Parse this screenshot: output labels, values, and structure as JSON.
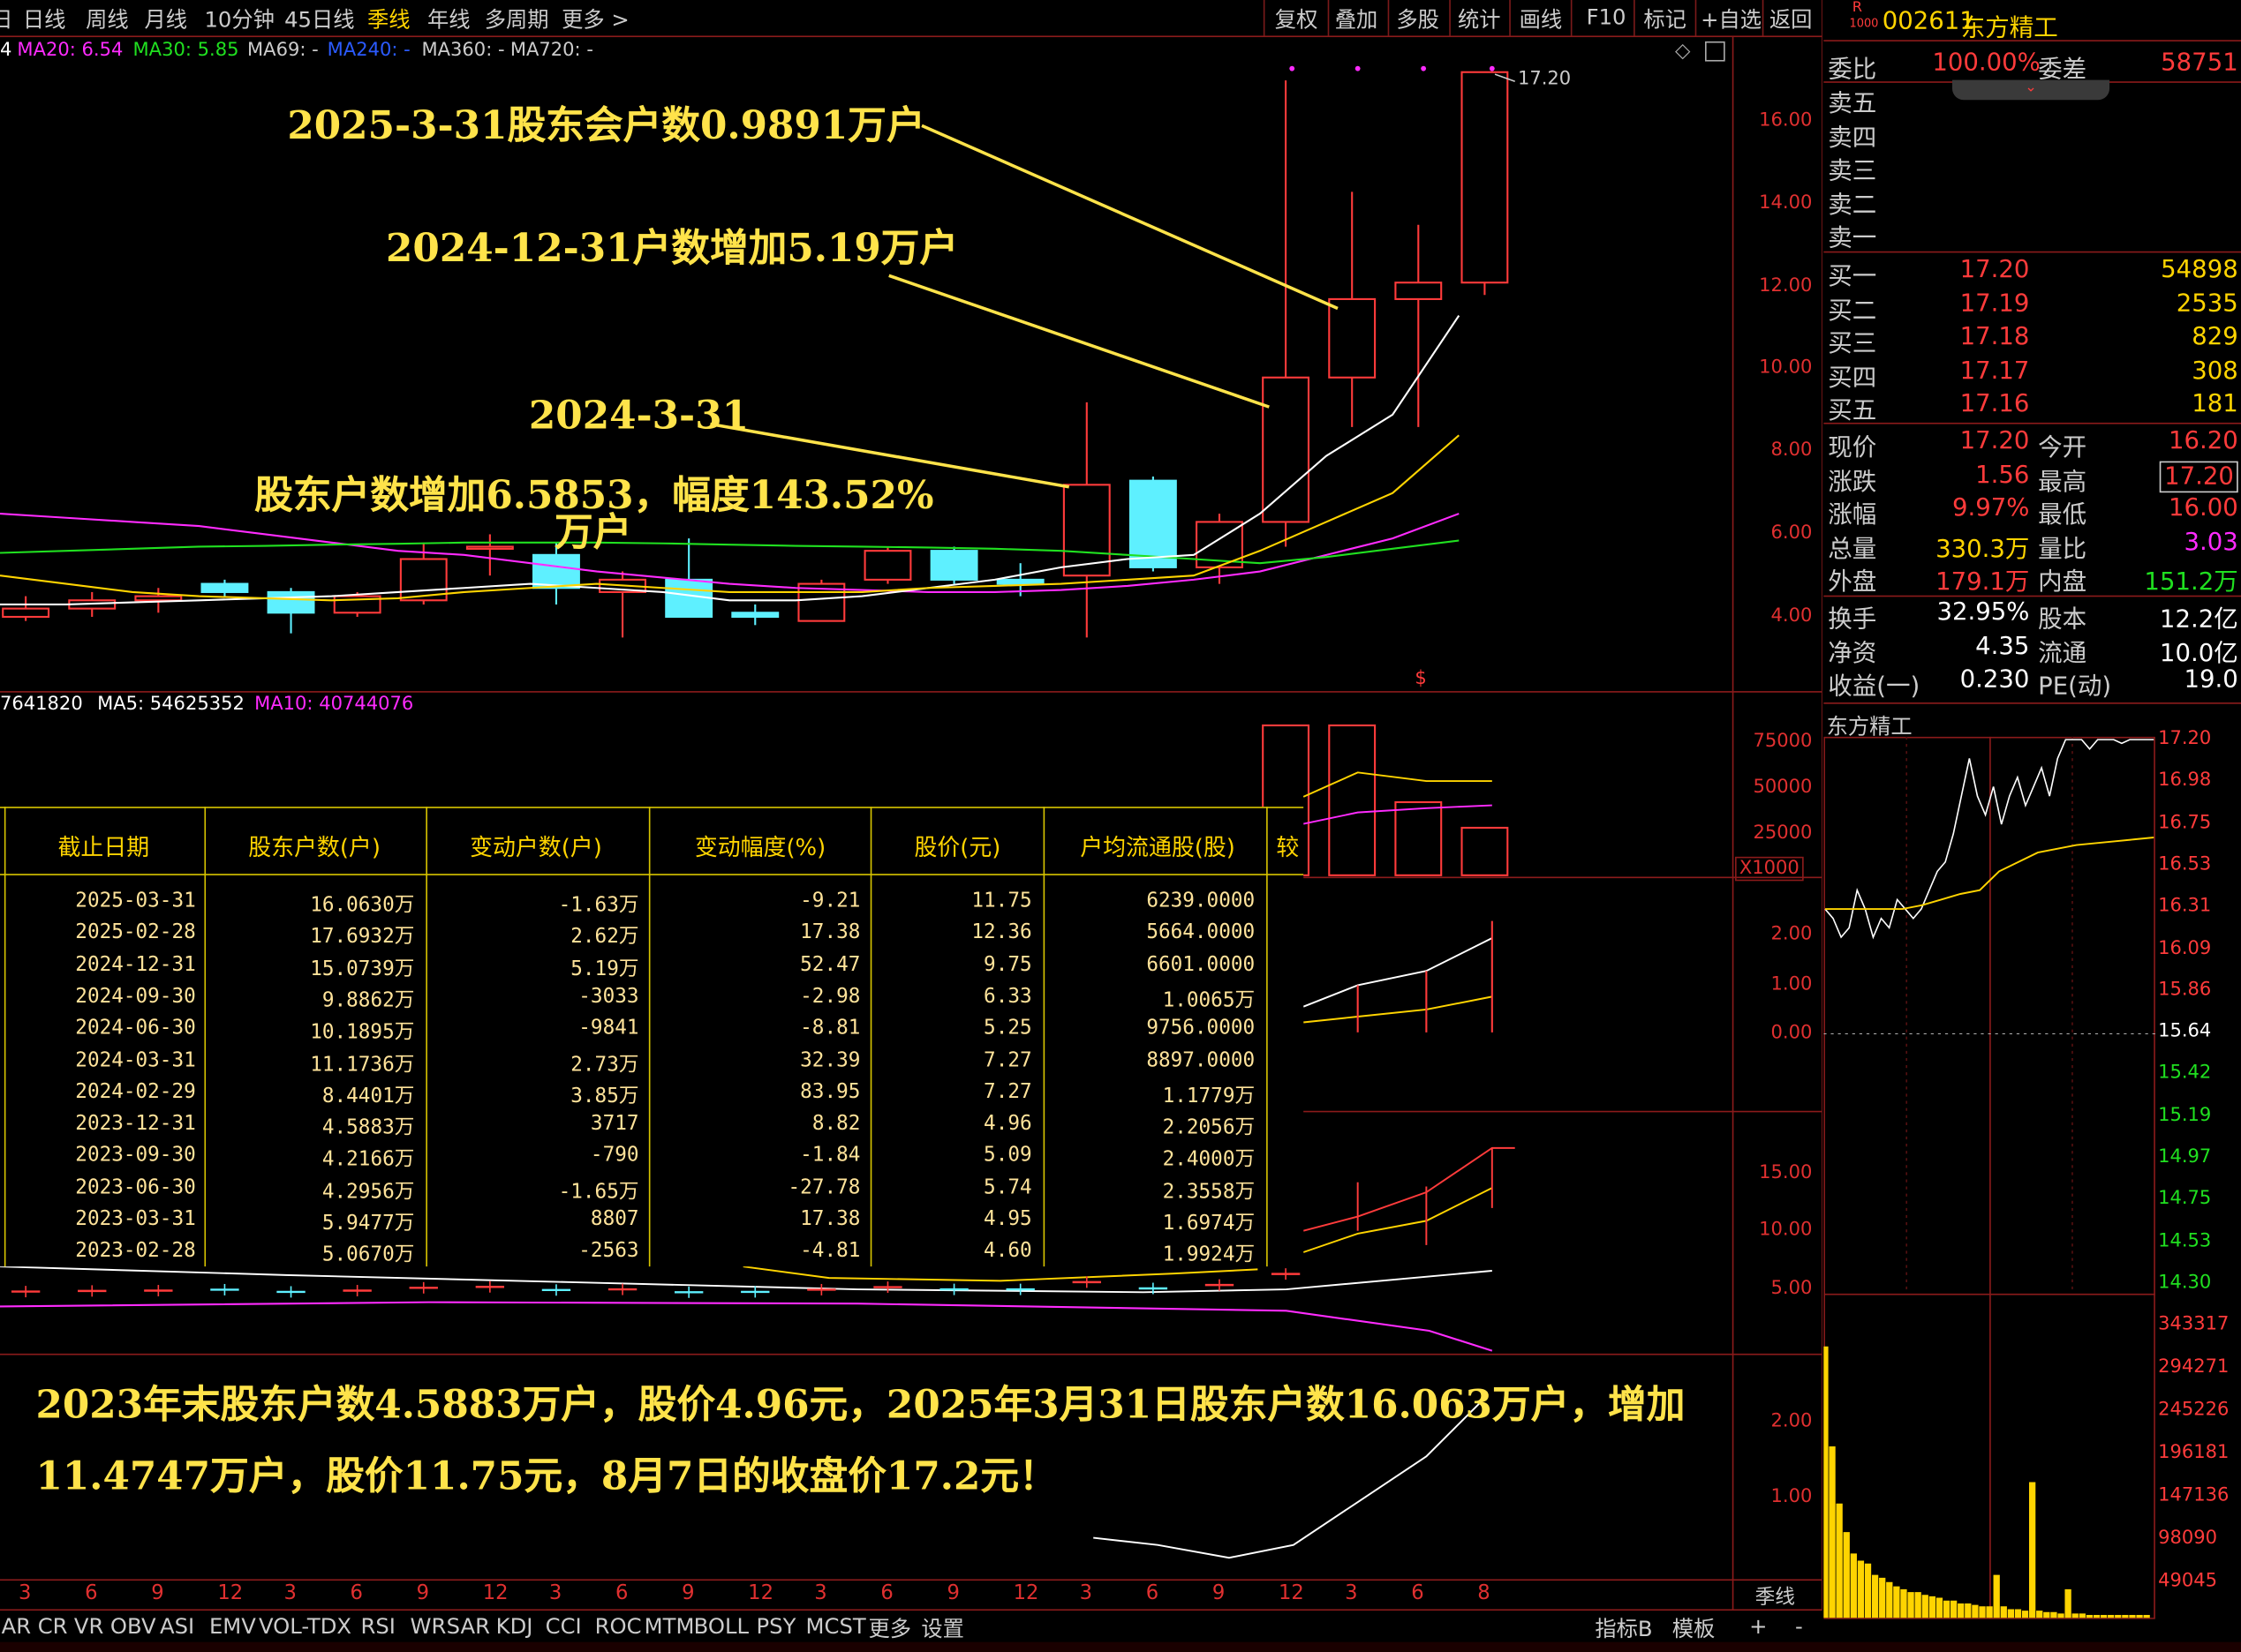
{
  "periods": [
    "日线",
    "周线",
    "月线",
    "10分钟",
    "45日线",
    "季线",
    "年线",
    "多周期",
    "更多 >"
  ],
  "active_period": "季线",
  "tools": [
    "复权",
    "叠加",
    "多股",
    "统计",
    "画线",
    "F10",
    "标记",
    "+自选",
    "返回"
  ],
  "stock": {
    "code": "002611",
    "name": "东方精工",
    "badge_top": "R",
    "badge_bottom": "1000"
  },
  "ma_line": [
    {
      "text": "4",
      "color": "#ffffff"
    },
    {
      "text": "MA20: 6.54",
      "color": "#ff2bff"
    },
    {
      "text": "MA30: 5.85",
      "color": "#20e020"
    },
    {
      "text": "MA69: -",
      "color": "#cccccc"
    },
    {
      "text": "MA240: -",
      "color": "#2b5bff"
    },
    {
      "text": "MA360: -",
      "color": "#cccccc"
    },
    {
      "text": "MA720: -",
      "color": "#cccccc"
    }
  ],
  "price_axis": [
    "16.00",
    "14.00",
    "12.00",
    "10.00",
    "8.00",
    "6.00",
    "4.00"
  ],
  "last_price_tag": "17.20",
  "vol_ma_line": [
    {
      "text": "7641820",
      "color": "#ffffff"
    },
    {
      "text": "MA5: 54625352",
      "color": "#ffffff"
    },
    {
      "text": "MA10: 40744076",
      "color": "#ff2bff"
    }
  ],
  "vol_axis": [
    "75000",
    "50000",
    "25000"
  ],
  "vol_unit": "X1000",
  "ind1_axis": [
    "2.00",
    "1.00",
    "0.00"
  ],
  "ind2_axis": [
    "15.00",
    "10.00",
    "5.00"
  ],
  "ind3_axis": [
    "2.00",
    "1.00"
  ],
  "marker_dollar": "$",
  "annotations": {
    "a1": "2025-3-31股东会户数0.9891万户",
    "a2": "2024-12-31户数增加5.19万户",
    "a3": "2024-3-31",
    "a4": "股东户数增加6.5853，幅度143.52%",
    "a4b": "万户",
    "bottom1": "2023年末股东户数4.5883万户，股价4.96元，2025年3月31日股东户数16.063万户，增加",
    "bottom2": "11.4747万户，股价11.75元，8月7日的收盘价17.2元！"
  },
  "table": {
    "headers": [
      "截止日期",
      "股东户数(户)",
      "变动户数(户)",
      "变动幅度(%)",
      "股价(元)",
      "户均流通股(股)",
      "较"
    ],
    "rows": [
      [
        "2025-03-31",
        "16.0630万",
        "-1.63万",
        "-9.21",
        "11.75",
        "6239.0000"
      ],
      [
        "2025-02-28",
        "17.6932万",
        "2.62万",
        "17.38",
        "12.36",
        "5664.0000"
      ],
      [
        "2024-12-31",
        "15.0739万",
        "5.19万",
        "52.47",
        "9.75",
        "6601.0000"
      ],
      [
        "2024-09-30",
        "9.8862万",
        "-3033",
        "-2.98",
        "6.33",
        "1.0065万"
      ],
      [
        "2024-06-30",
        "10.1895万",
        "-9841",
        "-8.81",
        "5.25",
        "9756.0000"
      ],
      [
        "2024-03-31",
        "11.1736万",
        "2.73万",
        "32.39",
        "7.27",
        "8897.0000"
      ],
      [
        "2024-02-29",
        "8.4401万",
        "3.85万",
        "83.95",
        "7.27",
        "1.1779万"
      ],
      [
        "2023-12-31",
        "4.5883万",
        "3717",
        "8.82",
        "4.96",
        "2.2056万"
      ],
      [
        "2023-09-30",
        "4.2166万",
        "-790",
        "-1.84",
        "5.09",
        "2.4000万"
      ],
      [
        "2023-06-30",
        "4.2956万",
        "-1.65万",
        "-27.78",
        "5.74",
        "2.3558万"
      ],
      [
        "2023-03-31",
        "5.9477万",
        "8807",
        "17.38",
        "4.95",
        "1.6974万"
      ],
      [
        "2023-02-28",
        "5.0670万",
        "-2563",
        "-4.81",
        "4.60",
        "1.9924万"
      ]
    ]
  },
  "x_ticks": [
    "3",
    "6",
    "9",
    "12",
    "3",
    "6",
    "9",
    "12",
    "3",
    "6",
    "9",
    "12",
    "3",
    "6",
    "9",
    "12",
    "3",
    "6",
    "9",
    "12",
    "3",
    "6",
    "8"
  ],
  "period_label": "季线",
  "bottom_tabs": [
    "AR",
    "CR",
    "VR",
    "OBV",
    "ASI",
    "EMV",
    "VOL-TDX",
    "RSI",
    "WR",
    "SAR",
    "KDJ",
    "CCI",
    "ROC",
    "MTM",
    "BOLL",
    "PSY",
    "MCST",
    "更多",
    "设置"
  ],
  "bottom_right_tabs": [
    "指标B",
    "模板",
    "+",
    "-"
  ],
  "quote": {
    "weibi_label": "委比",
    "weibi_value": "100.00%",
    "weicha_label": "委差",
    "weicha_value": "58751",
    "sells": [
      "卖五",
      "卖四",
      "卖三",
      "卖二",
      "卖一"
    ],
    "buys": [
      {
        "label": "买一",
        "price": "17.20",
        "vol": "54898"
      },
      {
        "label": "买二",
        "price": "17.19",
        "vol": "2535"
      },
      {
        "label": "买三",
        "price": "17.18",
        "vol": "829"
      },
      {
        "label": "买四",
        "price": "17.17",
        "vol": "308"
      },
      {
        "label": "买五",
        "price": "17.16",
        "vol": "181"
      }
    ],
    "stats": [
      {
        "l1": "现价",
        "v1": "17.20",
        "c1": "#ff3b3b",
        "l2": "今开",
        "v2": "16.20",
        "c2": "#ff3b3b"
      },
      {
        "l1": "涨跌",
        "v1": "1.56",
        "c1": "#ff3b3b",
        "l2": "最高",
        "v2": "17.20",
        "c2": "#ff3b3b"
      },
      {
        "l1": "涨幅",
        "v1": "9.97%",
        "c1": "#ff3b3b",
        "l2": "最低",
        "v2": "16.00",
        "c2": "#ff3b3b"
      },
      {
        "l1": "总量",
        "v1": "330.3万",
        "c1": "#ffd400",
        "l2": "量比",
        "v2": "3.03",
        "c2": "#ff2bff"
      },
      {
        "l1": "外盘",
        "v1": "179.1万",
        "c1": "#ff3b3b",
        "l2": "内盘",
        "v2": "151.2万",
        "c2": "#20e020"
      }
    ],
    "stats2": [
      {
        "l1": "换手",
        "v1": "32.95%",
        "l2": "股本",
        "v2": "12.2亿"
      },
      {
        "l1": "净资",
        "v1": "4.35",
        "l2": "流通",
        "v2": "10.0亿"
      },
      {
        "l1": "收益(一)",
        "v1": "0.230",
        "l2": "PE(动)",
        "v2": "19.0"
      }
    ]
  },
  "intraday": {
    "title": "东方精工",
    "price_axis": [
      "17.20",
      "16.98",
      "16.75",
      "16.53",
      "16.31",
      "16.09",
      "15.86",
      "15.64",
      "15.42",
      "15.19",
      "14.97",
      "14.75",
      "14.53",
      "14.30"
    ],
    "vol_axis": [
      "343317",
      "294271",
      "245226",
      "196181",
      "147136",
      "98090",
      "49045"
    ]
  },
  "chart_data": {
    "type": "candlestick",
    "period": "季线",
    "price_axis_range": [
      3.5,
      17.5
    ],
    "candles": [
      {
        "o": 4.0,
        "c": 4.2,
        "h": 4.5,
        "l": 3.9,
        "up": true
      },
      {
        "o": 4.2,
        "c": 4.4,
        "h": 4.6,
        "l": 4.0,
        "up": true
      },
      {
        "o": 4.4,
        "c": 4.5,
        "h": 4.7,
        "l": 4.1,
        "up": true
      },
      {
        "o": 4.6,
        "c": 4.8,
        "h": 4.9,
        "l": 4.5,
        "up": false
      },
      {
        "o": 4.6,
        "c": 4.1,
        "h": 4.7,
        "l": 3.6,
        "up": false
      },
      {
        "o": 4.1,
        "c": 4.5,
        "h": 4.6,
        "l": 4.0,
        "up": true
      },
      {
        "o": 4.4,
        "c": 5.4,
        "h": 5.8,
        "l": 4.3,
        "up": true
      },
      {
        "o": 5.7,
        "c": 5.7,
        "h": 6.0,
        "l": 5.0,
        "up": true
      },
      {
        "o": 5.5,
        "c": 4.7,
        "h": 5.8,
        "l": 4.3,
        "up": false
      },
      {
        "o": 4.6,
        "c": 4.9,
        "h": 5.1,
        "l": 3.5,
        "up": true
      },
      {
        "o": 4.9,
        "c": 4.0,
        "h": 5.9,
        "l": 4.0,
        "up": false
      },
      {
        "o": 4.0,
        "c": 4.1,
        "h": 4.3,
        "l": 3.8,
        "up": false
      },
      {
        "o": 3.9,
        "c": 4.8,
        "h": 4.9,
        "l": 3.9,
        "up": true
      },
      {
        "o": 4.9,
        "c": 5.6,
        "h": 5.7,
        "l": 4.8,
        "up": true
      },
      {
        "o": 5.6,
        "c": 4.9,
        "h": 5.7,
        "l": 4.8,
        "up": false
      },
      {
        "o": 4.8,
        "c": 4.9,
        "h": 5.3,
        "l": 4.5,
        "up": false
      },
      {
        "o": 5.0,
        "c": 7.2,
        "h": 9.2,
        "l": 3.5,
        "up": true
      },
      {
        "o": 7.3,
        "c": 5.2,
        "h": 7.4,
        "l": 5.1,
        "up": false
      },
      {
        "o": 5.2,
        "c": 6.3,
        "h": 6.5,
        "l": 4.8,
        "up": true
      },
      {
        "o": 6.3,
        "c": 9.8,
        "h": 17.0,
        "l": 5.7,
        "up": true
      },
      {
        "o": 9.8,
        "c": 11.7,
        "h": 14.3,
        "l": 8.6,
        "up": true
      },
      {
        "o": 11.7,
        "c": 12.1,
        "h": 13.5,
        "l": 8.6,
        "up": true
      },
      {
        "o": 12.1,
        "c": 17.2,
        "h": 17.2,
        "l": 11.8,
        "up": true
      }
    ],
    "ma_lines": [
      {
        "name": "MA20",
        "color": "#ff2bff",
        "values": [
          6.5,
          6.4,
          6.3,
          6.2,
          6.0,
          5.8,
          5.6,
          5.5,
          5.3,
          5.1,
          4.95,
          4.8,
          4.7,
          4.65,
          4.6,
          4.6,
          4.65,
          4.75,
          4.9,
          5.1,
          5.5,
          5.9,
          6.5
        ]
      },
      {
        "name": "MA30",
        "color": "#20e020",
        "values": [
          5.55,
          5.6,
          5.65,
          5.7,
          5.72,
          5.75,
          5.77,
          5.8,
          5.8,
          5.8,
          5.78,
          5.75,
          5.72,
          5.7,
          5.68,
          5.65,
          5.6,
          5.5,
          5.4,
          5.3,
          5.45,
          5.65,
          5.85
        ]
      },
      {
        "name": "MA5",
        "color": "#ffffff",
        "values": [
          4.3,
          4.3,
          4.35,
          4.4,
          4.45,
          4.5,
          4.6,
          4.7,
          4.8,
          4.7,
          4.6,
          4.4,
          4.4,
          4.5,
          4.7,
          4.9,
          5.2,
          5.4,
          5.5,
          6.5,
          7.9,
          8.9,
          11.3
        ]
      },
      {
        "name": "MA10",
        "color": "#ffd400",
        "values": [
          5.0,
          4.8,
          4.6,
          4.5,
          4.45,
          4.4,
          4.45,
          4.6,
          4.7,
          4.8,
          4.7,
          4.6,
          4.6,
          4.6,
          4.7,
          4.75,
          4.8,
          4.9,
          5.0,
          5.6,
          6.3,
          7.0,
          8.4
        ]
      }
    ],
    "volume_tail_x1000": [
      {
        "i": 16,
        "v": 30000,
        "up": true
      },
      {
        "i": 17,
        "v": 20000,
        "up": false
      },
      {
        "i": 18,
        "v": 18000,
        "up": true
      },
      {
        "i": 19,
        "v": 82000,
        "up": true
      },
      {
        "i": 20,
        "v": 82000,
        "up": true
      },
      {
        "i": 21,
        "v": 40000,
        "up": true
      },
      {
        "i": 22,
        "v": 26000,
        "up": true
      }
    ]
  }
}
